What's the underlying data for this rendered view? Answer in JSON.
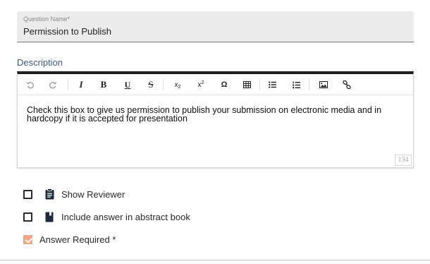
{
  "question_name": {
    "label": "Question Name*",
    "value": "Permission to Publish"
  },
  "description": {
    "label": "Description",
    "toolbar": [
      {
        "name": "undo-icon",
        "glyph": "⟲",
        "enabled": false
      },
      {
        "name": "redo-icon",
        "glyph": "⟳",
        "enabled": false
      },
      {
        "name": "italic-icon",
        "glyph": "I",
        "enabled": true
      },
      {
        "name": "bold-icon",
        "glyph": "B",
        "enabled": true
      },
      {
        "name": "underline-icon",
        "glyph": "U",
        "enabled": true
      },
      {
        "name": "strikethrough-icon",
        "glyph": "S",
        "enabled": true
      },
      {
        "name": "subscript-icon",
        "glyph": "x₂",
        "enabled": true
      },
      {
        "name": "superscript-icon",
        "glyph": "x²",
        "enabled": true
      },
      {
        "name": "special-character-icon",
        "glyph": "Ω",
        "enabled": true
      },
      {
        "name": "table-icon",
        "glyph": "table",
        "enabled": true
      },
      {
        "name": "bulleted-list-icon",
        "glyph": "ul",
        "enabled": true
      },
      {
        "name": "numbered-list-icon",
        "glyph": "ol",
        "enabled": true
      },
      {
        "name": "image-icon",
        "glyph": "img",
        "enabled": true
      },
      {
        "name": "link-icon",
        "glyph": "link",
        "enabled": true
      }
    ],
    "content": "Check this box to give us permission to publish your submission on electronic media and in hardcopy if it is accepted for presentation",
    "char_count": "134"
  },
  "options": {
    "show_reviewer": {
      "label": "Show Reviewer",
      "checked": false,
      "icon": "clipboard-icon"
    },
    "include_abstract": {
      "label": "Include answer in abstract book",
      "checked": false,
      "icon": "book-icon"
    },
    "answer_required": {
      "label": "Answer Required *",
      "checked": true
    }
  },
  "colors": {
    "accent_checkbox": "#f4a383",
    "description_label": "#3b5c88",
    "field_background": "#ececec"
  }
}
